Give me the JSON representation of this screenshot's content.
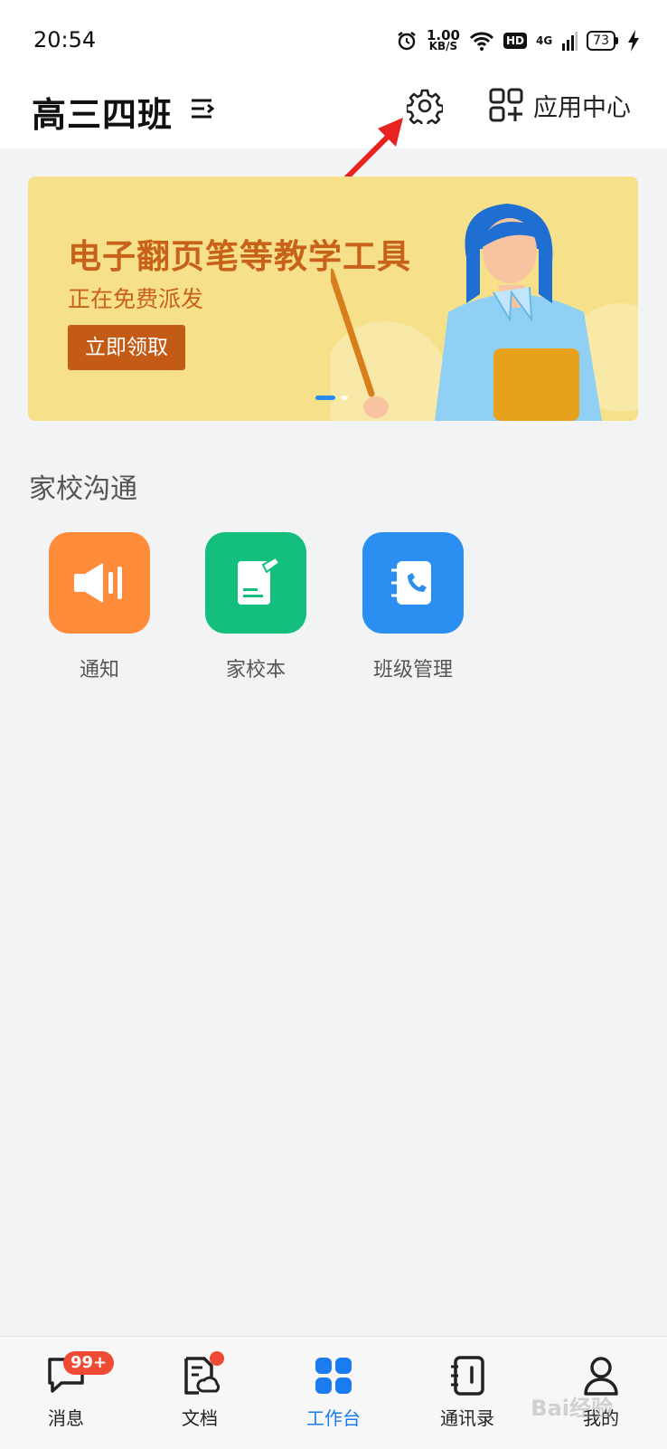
{
  "status_bar": {
    "time": "20:54",
    "net_speed_value": "1.00",
    "net_speed_unit": "KB/S",
    "hd": "HD",
    "network": "4G",
    "battery": "73"
  },
  "header": {
    "class_name": "高三四班",
    "app_center_label": "应用中心"
  },
  "banner": {
    "title": "电子翻页笔等教学工具",
    "subtitle": "正在免费派发",
    "button_label": "立即领取"
  },
  "section": {
    "title": "家校沟通",
    "apps": [
      {
        "label": "通知",
        "color": "#ff8c3a"
      },
      {
        "label": "家校本",
        "color": "#14bf7d"
      },
      {
        "label": "班级管理",
        "color": "#2b8ff2"
      }
    ]
  },
  "tabbar": {
    "tabs": [
      {
        "label": "消息",
        "badge": "99+"
      },
      {
        "label": "文档"
      },
      {
        "label": "工作台"
      },
      {
        "label": "通讯录"
      },
      {
        "label": "我的"
      }
    ],
    "active_color": "#1a7cf0"
  },
  "watermark": "Bai经验"
}
